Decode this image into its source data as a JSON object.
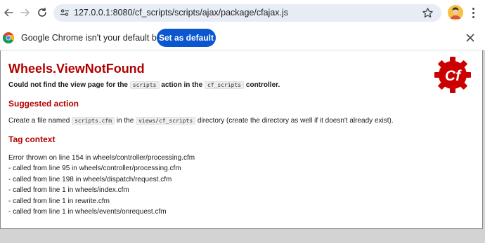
{
  "browser": {
    "url": "127.0.0.1:8080/cf_scripts/scripts/ajax/package/cfajax.js"
  },
  "infobar": {
    "message": "Google Chrome isn't your default browser",
    "button_label": "Set as default"
  },
  "error": {
    "title": "Wheels.ViewNotFound",
    "description": {
      "part1": "Could not find the view page for the ",
      "action_code": "scripts",
      "part2": " action in the ",
      "controller_code": "cf_scripts",
      "part3": " controller."
    },
    "suggested_action": {
      "heading": "Suggested action",
      "part1": "Create a file named ",
      "file_code": "scripts.cfm",
      "part2": " in the ",
      "dir_code": "views/cf_scripts",
      "part3": " directory (create the directory as well if it doesn't already exist)."
    },
    "tag_context": {
      "heading": "Tag context",
      "lines": [
        "Error thrown on line 154 in wheels/controller/processing.cfm",
        "- called from line 95 in wheels/controller/processing.cfm",
        "- called from line 198 in wheels/dispatch/request.cfm",
        "- called from line 1 in wheels/index.cfm",
        "- called from line 1 in rewrite.cfm",
        "- called from line 1 in wheels/events/onrequest.cfm"
      ]
    },
    "logo_text": "Cf"
  },
  "colors": {
    "error_red": "#b20000",
    "chrome_blue_button": "#0b57d0",
    "omnibox_bg": "#e8edf5",
    "logo_red": "#cc0000"
  },
  "icons": [
    "back-arrow-icon",
    "forward-arrow-icon",
    "reload-icon",
    "site-info-icon",
    "bookmark-star-icon",
    "profile-avatar-icon",
    "more-menu-icon",
    "chrome-logo-icon",
    "close-icon",
    "cfwheels-logo-icon"
  ]
}
